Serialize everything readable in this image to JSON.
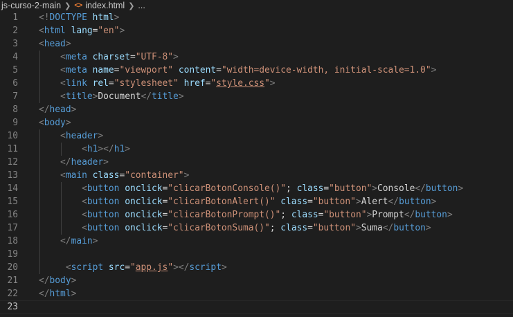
{
  "breadcrumb": {
    "folder": "js-curso-2-main",
    "file": "index.html",
    "more": "...",
    "file_icon": "<>"
  },
  "colors": {
    "background": "#1e1e1e",
    "tag": "#569cd6",
    "attribute": "#9cdcfe",
    "string": "#ce9178",
    "punctuation": "#808080",
    "text": "#d4d4d4",
    "line_number": "#858585"
  },
  "editor": {
    "current_line": 23,
    "lines": [
      {
        "n": "1",
        "tokens": [
          [
            "punct",
            "<!"
          ],
          [
            "tag",
            "DOCTYPE"
          ],
          [
            "text",
            " "
          ],
          [
            "attr",
            "html"
          ],
          [
            "punct",
            ">"
          ]
        ]
      },
      {
        "n": "2",
        "tokens": [
          [
            "punct",
            "<"
          ],
          [
            "tag",
            "html"
          ],
          [
            "text",
            " "
          ],
          [
            "attr",
            "lang"
          ],
          [
            "text",
            "="
          ],
          [
            "str",
            "\"en\""
          ],
          [
            "punct",
            ">"
          ]
        ]
      },
      {
        "n": "3",
        "tokens": [
          [
            "punct",
            "<"
          ],
          [
            "tag",
            "head"
          ],
          [
            "punct",
            ">"
          ]
        ]
      },
      {
        "n": "4",
        "tokens": [
          [
            "text",
            "    "
          ],
          [
            "punct",
            "<"
          ],
          [
            "tag",
            "meta"
          ],
          [
            "text",
            " "
          ],
          [
            "attr",
            "charset"
          ],
          [
            "text",
            "="
          ],
          [
            "str",
            "\"UTF-8\""
          ],
          [
            "punct",
            ">"
          ]
        ]
      },
      {
        "n": "5",
        "tokens": [
          [
            "text",
            "    "
          ],
          [
            "punct",
            "<"
          ],
          [
            "tag",
            "meta"
          ],
          [
            "text",
            " "
          ],
          [
            "attr",
            "name"
          ],
          [
            "text",
            "="
          ],
          [
            "str",
            "\"viewport\""
          ],
          [
            "text",
            " "
          ],
          [
            "attr",
            "content"
          ],
          [
            "text",
            "="
          ],
          [
            "str",
            "\"width=device-width, initial-scale=1.0\""
          ],
          [
            "punct",
            ">"
          ]
        ]
      },
      {
        "n": "6",
        "tokens": [
          [
            "text",
            "    "
          ],
          [
            "punct",
            "<"
          ],
          [
            "tag",
            "link"
          ],
          [
            "text",
            " "
          ],
          [
            "attr",
            "rel"
          ],
          [
            "text",
            "="
          ],
          [
            "str",
            "\"stylesheet\""
          ],
          [
            "text",
            " "
          ],
          [
            "attr",
            "href"
          ],
          [
            "text",
            "="
          ],
          [
            "str",
            "\""
          ],
          [
            "link",
            "style.css"
          ],
          [
            "str",
            "\""
          ],
          [
            "punct",
            ">"
          ]
        ]
      },
      {
        "n": "7",
        "tokens": [
          [
            "text",
            "    "
          ],
          [
            "punct",
            "<"
          ],
          [
            "tag",
            "title"
          ],
          [
            "punct",
            ">"
          ],
          [
            "text",
            "Document"
          ],
          [
            "punct",
            "</"
          ],
          [
            "tag",
            "title"
          ],
          [
            "punct",
            ">"
          ]
        ]
      },
      {
        "n": "8",
        "tokens": [
          [
            "punct",
            "</"
          ],
          [
            "tag",
            "head"
          ],
          [
            "punct",
            ">"
          ]
        ]
      },
      {
        "n": "9",
        "tokens": [
          [
            "punct",
            "<"
          ],
          [
            "tag",
            "body"
          ],
          [
            "punct",
            ">"
          ]
        ]
      },
      {
        "n": "10",
        "tokens": [
          [
            "text",
            "    "
          ],
          [
            "punct",
            "<"
          ],
          [
            "tag",
            "header"
          ],
          [
            "punct",
            ">"
          ]
        ]
      },
      {
        "n": "11",
        "tokens": [
          [
            "text",
            "        "
          ],
          [
            "punct",
            "<"
          ],
          [
            "tag",
            "h1"
          ],
          [
            "punct",
            "></"
          ],
          [
            "tag",
            "h1"
          ],
          [
            "punct",
            ">"
          ]
        ]
      },
      {
        "n": "12",
        "tokens": [
          [
            "text",
            "    "
          ],
          [
            "punct",
            "</"
          ],
          [
            "tag",
            "header"
          ],
          [
            "punct",
            ">"
          ]
        ]
      },
      {
        "n": "13",
        "tokens": [
          [
            "text",
            "    "
          ],
          [
            "punct",
            "<"
          ],
          [
            "tag",
            "main"
          ],
          [
            "text",
            " "
          ],
          [
            "attr",
            "class"
          ],
          [
            "text",
            "="
          ],
          [
            "str",
            "\"container\""
          ],
          [
            "punct",
            ">"
          ]
        ]
      },
      {
        "n": "14",
        "tokens": [
          [
            "text",
            "        "
          ],
          [
            "punct",
            "<"
          ],
          [
            "tag",
            "button"
          ],
          [
            "text",
            " "
          ],
          [
            "attr",
            "onclick"
          ],
          [
            "text",
            "="
          ],
          [
            "str",
            "\"clicarBotonConsole()\""
          ],
          [
            "text",
            "; "
          ],
          [
            "attr",
            "class"
          ],
          [
            "text",
            "="
          ],
          [
            "str",
            "\"button\""
          ],
          [
            "punct",
            ">"
          ],
          [
            "text",
            "Console"
          ],
          [
            "punct",
            "</"
          ],
          [
            "tag",
            "button"
          ],
          [
            "punct",
            ">"
          ]
        ]
      },
      {
        "n": "15",
        "tokens": [
          [
            "text",
            "        "
          ],
          [
            "punct",
            "<"
          ],
          [
            "tag",
            "button"
          ],
          [
            "text",
            " "
          ],
          [
            "attr",
            "onclick"
          ],
          [
            "text",
            "="
          ],
          [
            "str",
            "\"clicarBotonAlert()\""
          ],
          [
            "text",
            " "
          ],
          [
            "attr",
            "class"
          ],
          [
            "text",
            "="
          ],
          [
            "str",
            "\"button\""
          ],
          [
            "punct",
            ">"
          ],
          [
            "text",
            "Alert"
          ],
          [
            "punct",
            "</"
          ],
          [
            "tag",
            "button"
          ],
          [
            "punct",
            ">"
          ]
        ]
      },
      {
        "n": "16",
        "tokens": [
          [
            "text",
            "        "
          ],
          [
            "punct",
            "<"
          ],
          [
            "tag",
            "button"
          ],
          [
            "text",
            " "
          ],
          [
            "attr",
            "onclick"
          ],
          [
            "text",
            "="
          ],
          [
            "str",
            "\"clicarBotonPrompt()\""
          ],
          [
            "text",
            "; "
          ],
          [
            "attr",
            "class"
          ],
          [
            "text",
            "="
          ],
          [
            "str",
            "\"button\""
          ],
          [
            "punct",
            ">"
          ],
          [
            "text",
            "Prompt"
          ],
          [
            "punct",
            "</"
          ],
          [
            "tag",
            "button"
          ],
          [
            "punct",
            ">"
          ]
        ]
      },
      {
        "n": "17",
        "tokens": [
          [
            "text",
            "        "
          ],
          [
            "punct",
            "<"
          ],
          [
            "tag",
            "button"
          ],
          [
            "text",
            " "
          ],
          [
            "attr",
            "onclick"
          ],
          [
            "text",
            "="
          ],
          [
            "str",
            "\"clicarBotonSuma()\""
          ],
          [
            "text",
            "; "
          ],
          [
            "attr",
            "class"
          ],
          [
            "text",
            "="
          ],
          [
            "str",
            "\"button\""
          ],
          [
            "punct",
            ">"
          ],
          [
            "text",
            "Suma"
          ],
          [
            "punct",
            "</"
          ],
          [
            "tag",
            "button"
          ],
          [
            "punct",
            ">"
          ]
        ]
      },
      {
        "n": "18",
        "tokens": [
          [
            "text",
            "    "
          ],
          [
            "punct",
            "</"
          ],
          [
            "tag",
            "main"
          ],
          [
            "punct",
            ">"
          ]
        ]
      },
      {
        "n": "19",
        "tokens": []
      },
      {
        "n": "20",
        "tokens": [
          [
            "text",
            "     "
          ],
          [
            "punct",
            "<"
          ],
          [
            "tag",
            "script"
          ],
          [
            "text",
            " "
          ],
          [
            "attr",
            "src"
          ],
          [
            "text",
            "="
          ],
          [
            "str",
            "\""
          ],
          [
            "link",
            "app.js"
          ],
          [
            "str",
            "\""
          ],
          [
            "punct",
            "></"
          ],
          [
            "tag",
            "script"
          ],
          [
            "punct",
            ">"
          ]
        ]
      },
      {
        "n": "21",
        "tokens": [
          [
            "punct",
            "</"
          ],
          [
            "tag",
            "body"
          ],
          [
            "punct",
            ">"
          ]
        ]
      },
      {
        "n": "22",
        "tokens": [
          [
            "punct",
            "</"
          ],
          [
            "tag",
            "html"
          ],
          [
            "punct",
            ">"
          ]
        ]
      },
      {
        "n": "23",
        "tokens": []
      }
    ]
  }
}
